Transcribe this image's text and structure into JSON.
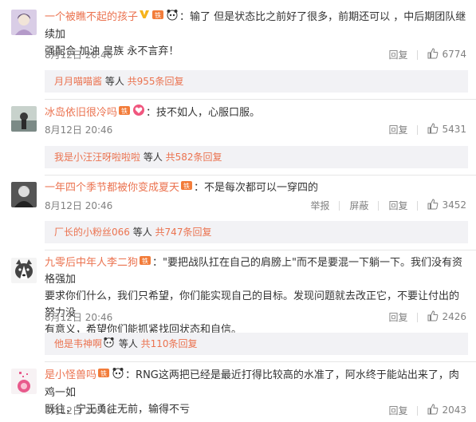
{
  "comments": [
    {
      "username": "一个被瞧不起的孩子",
      "sep": "：",
      "text_line1": "输了 但是状态比之前好了很多，前期还可以 ，中后期团队继续加",
      "text_line2": "强配合 加油 皇族 永不言弃！",
      "time": "8月12日 20:46",
      "reply_label": "回复",
      "likes": "6774",
      "replies": {
        "name": "月月喵喵酱",
        "mid": " 等人 ",
        "count": "共955条回复"
      }
    },
    {
      "username": "冰岛依旧很冷吗",
      "sep": "：",
      "text_line1": "技不如人，心服口服。",
      "time": "8月12日 20:46",
      "reply_label": "回复",
      "likes": "5431",
      "replies": {
        "name": "我是小汪汪呀啦啦啦",
        "mid": " 等人 ",
        "count": "共582条回复"
      }
    },
    {
      "username": "一年四个季节都被你变成夏天",
      "sep": "：",
      "text_line1": "不是每次都可以一穿四的",
      "time": "8月12日 20:46",
      "report_label": "举报",
      "block_label": "屏蔽",
      "reply_label": "回复",
      "likes": "3452",
      "replies": {
        "name": "厂长的小粉丝066",
        "mid": " 等人 ",
        "count": "共747条回复"
      }
    },
    {
      "username": "九零后中年人李二狗",
      "sep": "：",
      "text_line1": "\"要把战队扛在自己的肩膀上\"而不是要混一下躺一下。我们没有资格强加",
      "text_line2": "要求你们什么，我们只希望，你们能实现自己的目标。发现问题就去改正它，不要让付出的努力没",
      "text_line3": "有意义，希望你们能抓紧找回状态和自信。",
      "time": "8月12日 20:46",
      "reply_label": "回复",
      "likes": "2426",
      "replies": {
        "name": "他是韦神啊",
        "mid": " 等人 ",
        "count": "共110条回复"
      }
    },
    {
      "username": "是小怪兽吗",
      "sep": "：",
      "text_line1": "RNG这两把已经是最近打得比较高的水准了，阿水终于能站出来了，肉鸡一如",
      "text_line2": "既往，宁王勇往无前，输得不亏",
      "time": "8月12日 20:46",
      "reply_label": "回复",
      "likes": "2043"
    }
  ],
  "colors": {
    "username": "#eb7350",
    "meta": "#808080",
    "reply_bg": "#f2f2f5"
  },
  "icons": [
    "vip-v-icon",
    "fan-badge-icon",
    "panda-emoji-icon",
    "heart-emoji-icon",
    "thumb-up-icon"
  ]
}
